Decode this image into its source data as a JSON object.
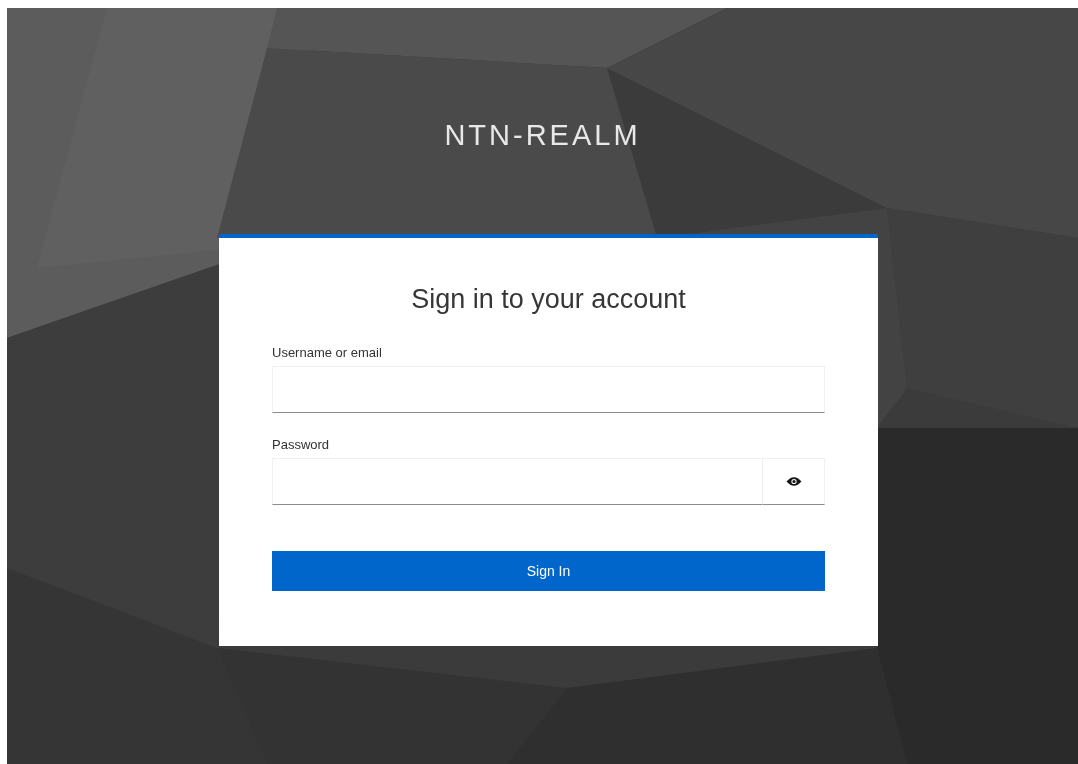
{
  "realm_title": "NTN-REALM",
  "login_card": {
    "heading": "Sign in to your account",
    "fields": [
      {
        "kind": "text",
        "label": "Username or email"
      },
      {
        "kind": "password",
        "label": "Password"
      }
    ],
    "submit_button": "Sign In"
  }
}
